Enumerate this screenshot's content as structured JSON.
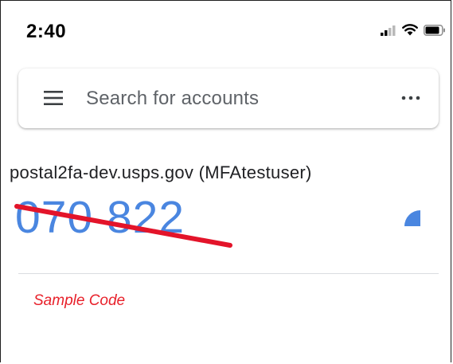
{
  "status_bar": {
    "time": "2:40",
    "icons": [
      "signal-icon",
      "wifi-icon",
      "battery-icon"
    ]
  },
  "search": {
    "placeholder": "Search for accounts",
    "menu_icon": "hamburger-menu-icon",
    "more_icon": "more-horizontal-icon"
  },
  "account": {
    "name": "postal2fa-dev.usps.gov (MFAtestuser)",
    "code": "070 822",
    "timer_icon": "countdown-timer-icon"
  },
  "annotation": {
    "label": "Sample Code",
    "strike_color": "#e3142a"
  },
  "colors": {
    "code_blue": "#4a86e0",
    "annotation_red": "#e8202a",
    "divider": "#dadce0"
  }
}
